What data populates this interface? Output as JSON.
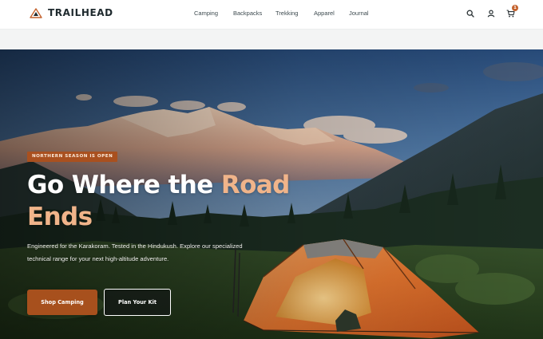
{
  "brand": {
    "name": "TRAILHEAD",
    "logo_icon": "mountain-logo-icon"
  },
  "nav": {
    "items": [
      {
        "label": "Camping"
      },
      {
        "label": "Backpacks"
      },
      {
        "label": "Trekking"
      },
      {
        "label": "Apparel"
      },
      {
        "label": "Journal"
      }
    ]
  },
  "header_icons": {
    "search": "search-icon",
    "account": "user-icon",
    "cart": "cart-icon",
    "cart_count": "1"
  },
  "hero": {
    "badge": "NORTHERN SEASON IS OPEN",
    "title_line1": "Go Where the",
    "title_accent1": "Road",
    "title_accent2": "Ends",
    "description": "Engineered for the Karakoram. Tested in the Hindukush. Explore our specialized technical range for your next high-altitude adventure.",
    "primary_cta": "Shop Camping",
    "secondary_cta": "Plan Your Kit"
  },
  "colors": {
    "accent": "#a9501f",
    "accent_light": "#f0b48a",
    "header_bg": "#ffffff",
    "subbar_bg": "#f3f4f4"
  }
}
